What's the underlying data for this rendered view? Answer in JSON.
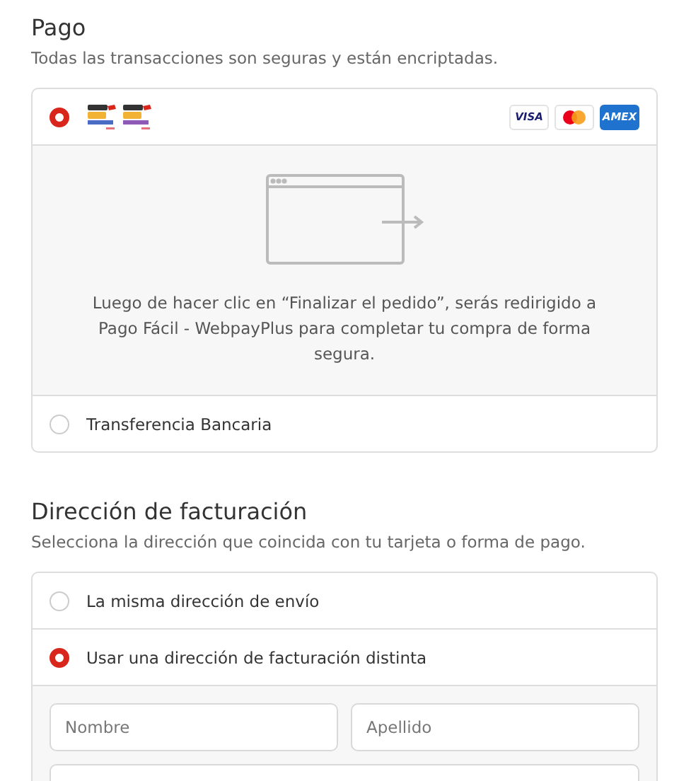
{
  "payment": {
    "title": "Pago",
    "subtitle": "Todas las transacciones son seguras y están encriptadas.",
    "options": [
      {
        "kind": "webpay",
        "selected": true,
        "cards": [
          {
            "kind": "visa",
            "label": "VISA"
          },
          {
            "kind": "mastercard"
          },
          {
            "kind": "amex",
            "label": "AMEX"
          }
        ],
        "note": "Luego de hacer clic en “Finalizar el pedido”, serás redirigido a Pago Fácil - WebpayPlus para completar tu compra de forma segura."
      },
      {
        "kind": "label",
        "selected": false,
        "label": "Transferencia Bancaria"
      }
    ]
  },
  "billing": {
    "title": "Dirección de facturación",
    "subtitle": "Selecciona la dirección que coincida con tu tarjeta o forma de pago.",
    "options": [
      {
        "label": "La misma dirección de envío",
        "selected": false
      },
      {
        "label": "Usar una dirección de facturación distinta",
        "selected": true
      }
    ],
    "fields": [
      {
        "placeholder": "Nombre"
      },
      {
        "placeholder": "Apellido"
      }
    ],
    "more_fields": [
      {
        "kind": "input"
      }
    ]
  }
}
